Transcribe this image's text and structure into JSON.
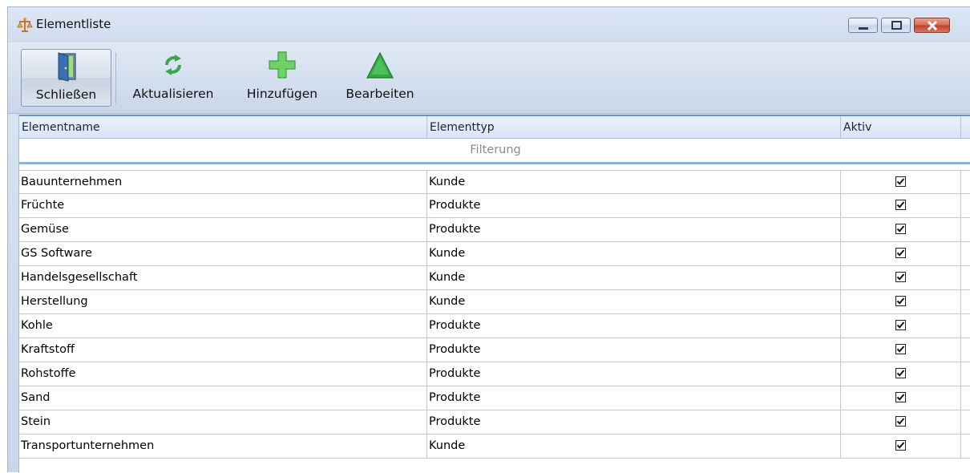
{
  "window": {
    "title": "Elementliste"
  },
  "toolbar": {
    "close_label": "Schließen",
    "refresh_label": "Aktualisieren",
    "add_label": "Hinzufügen",
    "edit_label": "Bearbeiten"
  },
  "grid": {
    "columns": [
      "Elementname",
      "Elementtyp",
      "Aktiv"
    ],
    "filter_placeholder": "Filterung",
    "rows": [
      {
        "name": "Bauunternehmen",
        "type": "Kunde",
        "active": true
      },
      {
        "name": "Früchte",
        "type": "Produkte",
        "active": true
      },
      {
        "name": "Gemüse",
        "type": "Produkte",
        "active": true
      },
      {
        "name": "GS Software",
        "type": "Kunde",
        "active": true
      },
      {
        "name": "Handelsgesellschaft",
        "type": "Kunde",
        "active": true
      },
      {
        "name": "Herstellung",
        "type": "Kunde",
        "active": true
      },
      {
        "name": "Kohle",
        "type": "Produkte",
        "active": true
      },
      {
        "name": "Kraftstoff",
        "type": "Produkte",
        "active": true
      },
      {
        "name": "Rohstoffe",
        "type": "Produkte",
        "active": true
      },
      {
        "name": "Sand",
        "type": "Produkte",
        "active": true
      },
      {
        "name": "Stein",
        "type": "Produkte",
        "active": true
      },
      {
        "name": "Transportunternehmen",
        "type": "Kunde",
        "active": true
      }
    ]
  },
  "colors": {
    "header_accent": "#6d92c8",
    "close_button": "#c1432c",
    "add_icon": "#5cc45a",
    "edit_icon": "#2f9a3a"
  }
}
